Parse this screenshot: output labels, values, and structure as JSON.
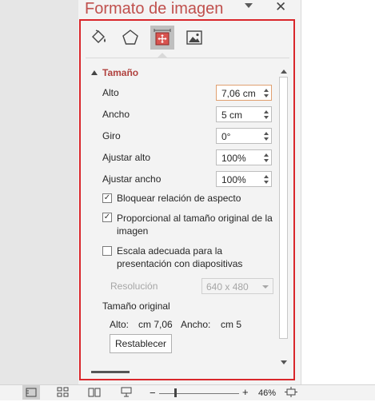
{
  "pane": {
    "title": "Formato de imagen",
    "tabs": [
      {
        "name": "fill-line-tab",
        "icon": "paint-bucket-icon"
      },
      {
        "name": "effects-tab",
        "icon": "pentagon-icon"
      },
      {
        "name": "size-properties-tab",
        "icon": "size-properties-icon",
        "active": true
      },
      {
        "name": "picture-tab",
        "icon": "picture-icon"
      }
    ],
    "section_title": "Tamaño",
    "fields": {
      "alto_label": "Alto",
      "alto_value": "7,06 cm",
      "ancho_label": "Ancho",
      "ancho_value": "5 cm",
      "giro_label": "Giro",
      "giro_value": "0°",
      "ajustar_alto_label": "Ajustar alto",
      "ajustar_alto_value": "100%",
      "ajustar_ancho_label": "Ajustar ancho",
      "ajustar_ancho_value": "100%"
    },
    "checkboxes": {
      "lock_aspect_label": "Bloquear relación de aspecto",
      "lock_aspect_checked": true,
      "relative_original_label": "Proporcional al tamaño original de la imagen",
      "relative_original_checked": true,
      "best_scale_label": "Escala adecuada para la presentación con diapositivas",
      "best_scale_checked": false
    },
    "resolution_label": "Resolución",
    "resolution_value": "640 x 480",
    "original_size_title": "Tamaño original",
    "original_alto_label": "Alto:",
    "original_alto_value": "cm 7,06",
    "original_ancho_label": "Ancho:",
    "original_ancho_value": "cm 5",
    "reset_button": "Restablecer"
  },
  "status_bar": {
    "zoom_value": "46%",
    "zoom_minus": "−",
    "zoom_plus": "+",
    "zoom_fraction": 0.23
  },
  "colors": {
    "accent": "#c0504d",
    "highlight": "#d9262b"
  }
}
